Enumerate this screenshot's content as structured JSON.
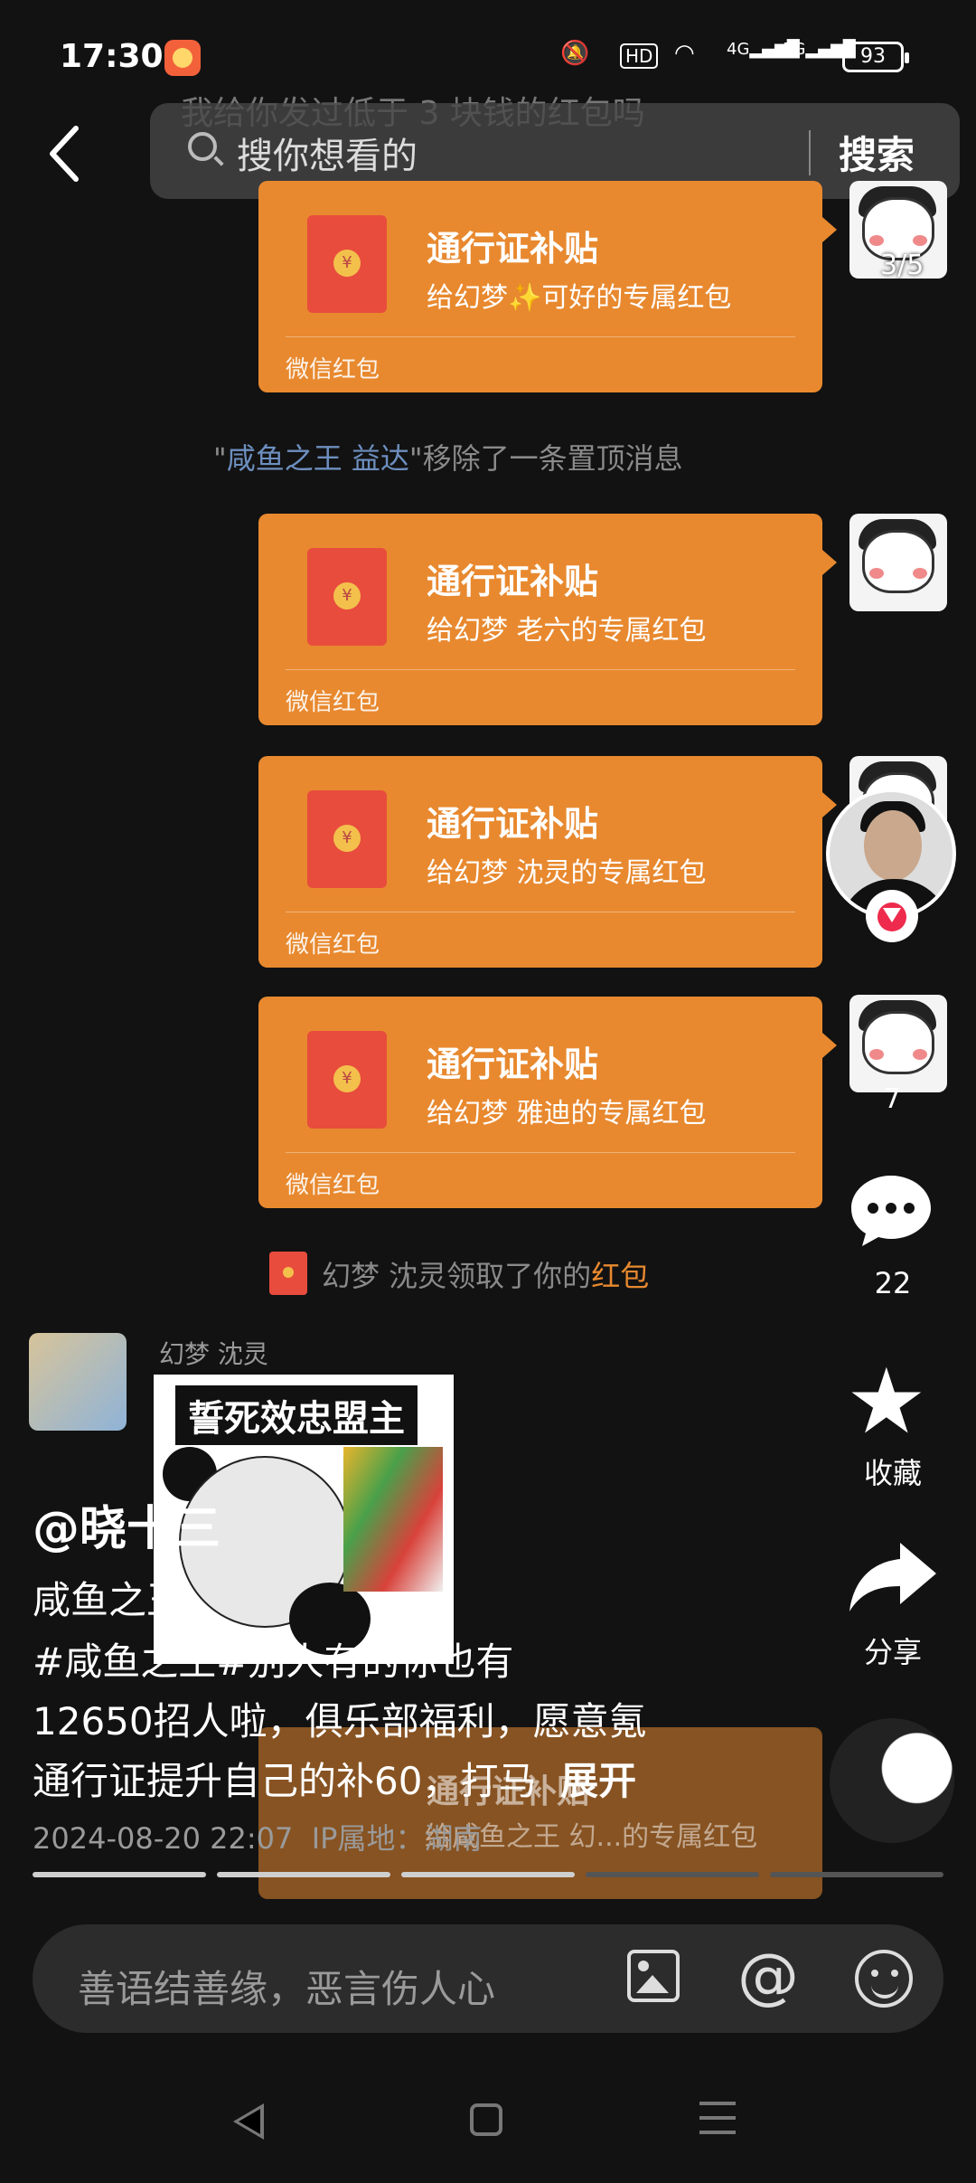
{
  "status_bar": {
    "time": "17:30",
    "network_hd": "HD",
    "network_4g": "4G",
    "network_5g": "5G",
    "battery": "93"
  },
  "search": {
    "overlap_text": "我给你发过低于 3 块钱的红包吗",
    "placeholder": "搜你想看的",
    "button": "搜索"
  },
  "packets": [
    {
      "title": "通行证补贴",
      "subtitle": "给幻梦✨可好的专属红包",
      "footer": "微信红包"
    },
    {
      "title": "通行证补贴",
      "subtitle": "给幻梦 老六的专属红包",
      "footer": "微信红包"
    },
    {
      "title": "通行证补贴",
      "subtitle": "给幻梦 沈灵的专属红包",
      "footer": "微信红包"
    },
    {
      "title": "通行证补贴",
      "subtitle": "给幻梦 雅迪的专属红包",
      "footer": "微信红包"
    }
  ],
  "image_counter": "3/5",
  "system_message": {
    "quote_open": "\"",
    "name": "咸鱼之王 益达",
    "quote_rest": "\"移除了一条置顶消息"
  },
  "receive_message": {
    "text": "幻梦 沈灵领取了你的",
    "highlight": "红包"
  },
  "sticker": {
    "sender": "幻梦 沈灵",
    "caption": "誓死效忠盟主"
  },
  "actions": {
    "like_count": "7",
    "comment_count": "22",
    "favorite_label": "收藏",
    "share_label": "分享"
  },
  "post": {
    "author": "@晓十三",
    "lines": [
      "咸鱼之王",
      "#咸鱼之王#别人有的你也有",
      "12650招人啦，俱乐部福利，愿意氪",
      "通行证提升自己的补60，打马"
    ],
    "expand": "展开",
    "ghost_title": "通行证补贴",
    "meta_date": "2024-08-20 22:07",
    "meta_ip": "IP属地：湖南",
    "ghost_sub": "给咸鱼之王 幻...的专属红包"
  },
  "comment_bar": {
    "placeholder": "善语结善缘，恶言伤人心"
  }
}
